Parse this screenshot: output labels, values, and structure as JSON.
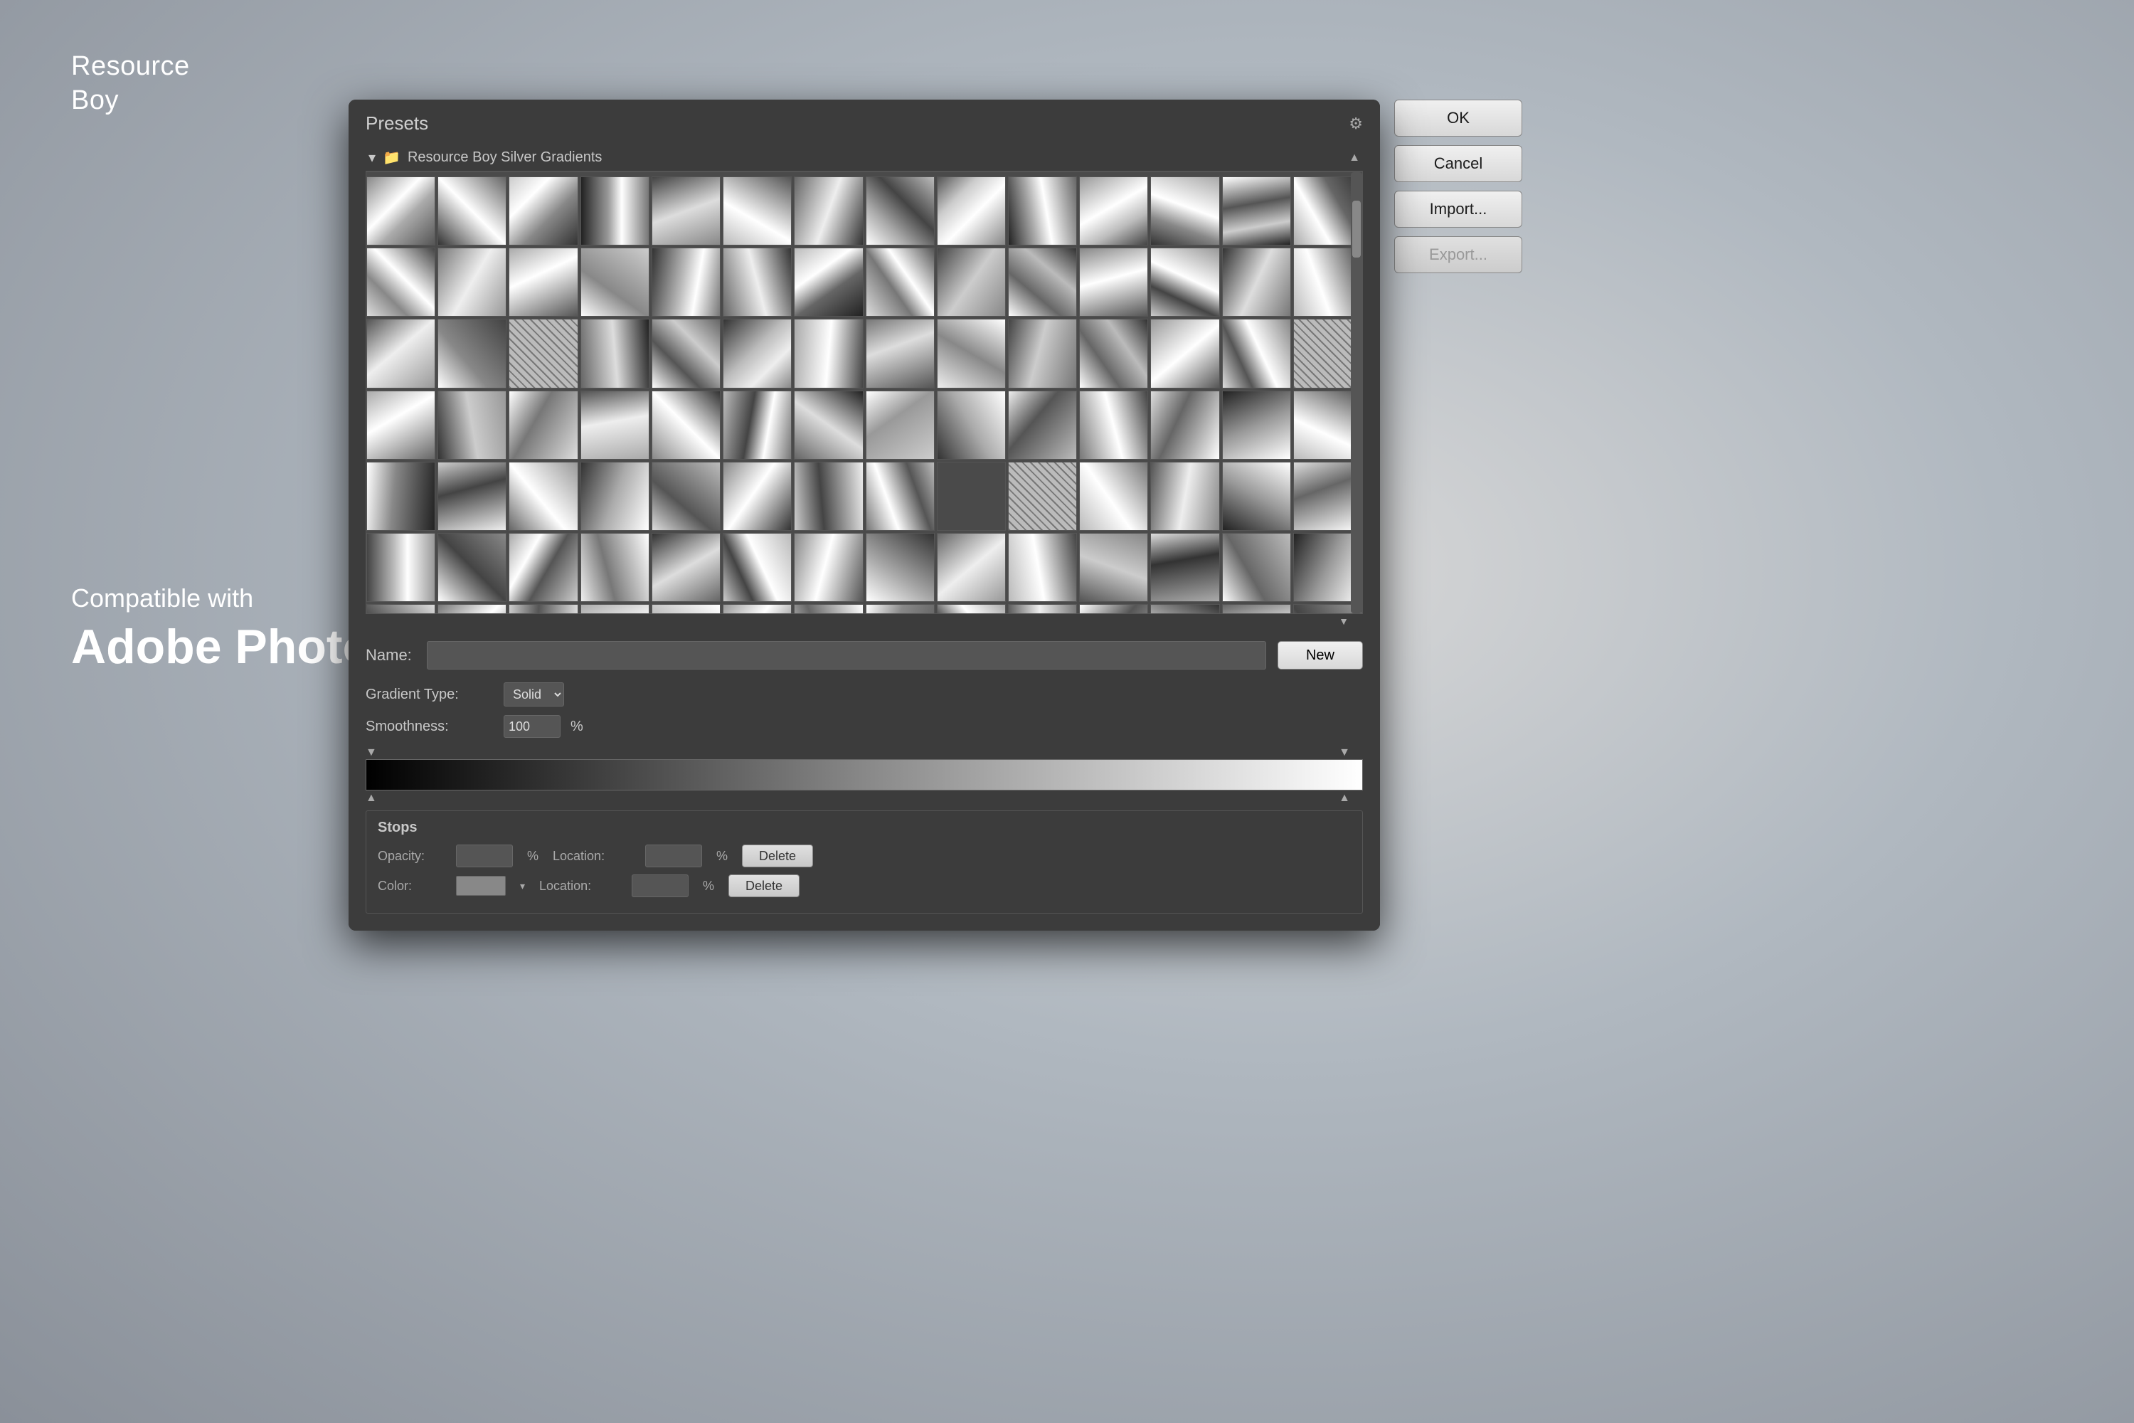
{
  "watermark": {
    "line1": "Resource",
    "line2": "Boy"
  },
  "compat": {
    "sub": "Compatible with",
    "main": "Adobe Photoshop"
  },
  "dialog": {
    "presets_label": "Presets",
    "gear_label": "⚙",
    "folder_name": "Resource Boy Silver Gradients",
    "name_label": "Name:",
    "name_value": "",
    "new_btn": "New",
    "gradient_type_label": "Gradient Type:",
    "gradient_type_value": "Solid",
    "smoothness_label": "Smoothness:",
    "smoothness_value": "100",
    "smoothness_unit": "%",
    "stops_title": "Stops",
    "opacity_label": "Opacity:",
    "opacity_pct": "%",
    "location_label": "Location:",
    "location_pct": "%",
    "delete_label": "Delete",
    "color_label": "Color:",
    "color_loc_label": "Location:",
    "color_loc_pct": "%",
    "color_delete": "Delete"
  },
  "buttons": {
    "ok": "OK",
    "cancel": "Cancel",
    "import": "Import...",
    "export": "Export..."
  }
}
